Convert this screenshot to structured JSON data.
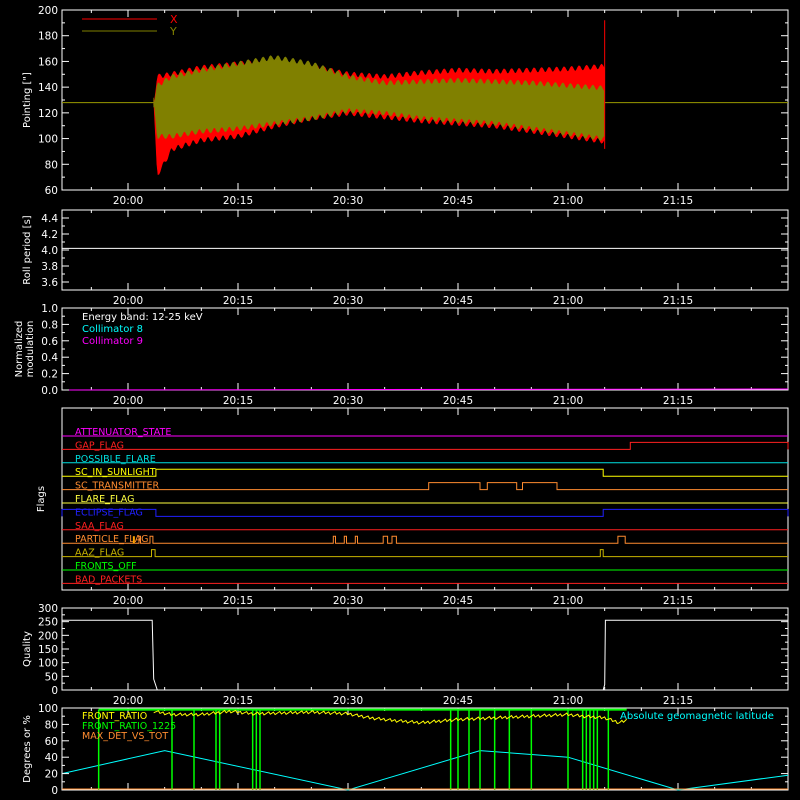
{
  "figure": {
    "background": "#000000",
    "foreground": "#ffffff"
  },
  "time_axis": {
    "ticks": [
      "20:00",
      "20:15",
      "20:30",
      "20:45",
      "21:00",
      "21:15"
    ],
    "tick_minutes": [
      1200,
      1215,
      1230,
      1245,
      1260,
      1275
    ],
    "range_minutes": [
      1191,
      1290
    ]
  },
  "chart_data": [
    {
      "id": "pointing",
      "type": "area",
      "ylabel": "Pointing [\"]",
      "ylim": [
        60,
        200
      ],
      "yticks": [
        60,
        80,
        100,
        120,
        140,
        160,
        180,
        200
      ],
      "legend": [
        {
          "name": "X",
          "color": "#ff0000"
        },
        {
          "name": "Y",
          "color": "#808000"
        }
      ],
      "baseline": {
        "y": 128,
        "color": "#9a9a00"
      },
      "data_span_minutes": [
        1203.5,
        1265
      ],
      "series": [
        {
          "name": "X",
          "color": "#ff0000",
          "x": [
            1203.5,
            1204,
            1206,
            1210,
            1215,
            1220,
            1225,
            1230,
            1235,
            1240,
            1245,
            1250,
            1255,
            1260,
            1265
          ],
          "upper": [
            128,
            150,
            152,
            157,
            160,
            162,
            158,
            152,
            150,
            153,
            155,
            154,
            155,
            156,
            158
          ],
          "lower": [
            128,
            70,
            90,
            97,
            100,
            108,
            114,
            118,
            115,
            112,
            110,
            108,
            104,
            100,
            96
          ]
        },
        {
          "name": "Y",
          "color": "#808000",
          "x": [
            1203.5,
            1204,
            1206,
            1210,
            1215,
            1220,
            1225,
            1230,
            1235,
            1240,
            1245,
            1250,
            1255,
            1260,
            1265
          ],
          "upper": [
            128,
            143,
            150,
            155,
            160,
            165,
            160,
            150,
            145,
            146,
            147,
            146,
            145,
            143,
            141
          ],
          "lower": [
            128,
            100,
            100,
            104,
            106,
            110,
            114,
            120,
            118,
            114,
            112,
            110,
            106,
            102,
            98
          ]
        }
      ]
    },
    {
      "id": "roll",
      "type": "line",
      "ylabel": "Roll period [s]",
      "ylim": [
        3.5,
        4.5
      ],
      "yticks": [
        3.6,
        3.8,
        4.0,
        4.2,
        4.4
      ],
      "series": [
        {
          "name": "",
          "color": "#ffffff",
          "x": [
            1191,
            1290
          ],
          "y": [
            4.02,
            4.02
          ]
        }
      ]
    },
    {
      "id": "modulation",
      "type": "line",
      "ylabel": [
        "Normalized",
        "modulation"
      ],
      "ylim": [
        0,
        1
      ],
      "yticks": [
        0.0,
        0.2,
        0.4,
        0.6,
        0.8,
        1.0
      ],
      "text_lines": [
        {
          "text": "Energy band: 12-25 keV",
          "color": "#ffffff"
        },
        {
          "text": "Collimator 8",
          "color": "#00ffff"
        },
        {
          "text": "Collimator 9",
          "color": "#ff00ff"
        }
      ],
      "series": [
        {
          "name": "Collimator 9",
          "color": "#ff00ff",
          "x": [
            1191,
            1290
          ],
          "y": [
            0,
            0
          ]
        }
      ]
    },
    {
      "id": "flags",
      "type": "line",
      "ylabel": "Flags",
      "flags": [
        {
          "name": "ATTENUATOR_STATE",
          "color": "#ff00ff",
          "segments": []
        },
        {
          "name": "GAP_FLAG",
          "color": "#ff2020",
          "segments": [
            [
              1268.5,
              1290
            ]
          ]
        },
        {
          "name": "POSSIBLE_FLARE",
          "color": "#00e0e0",
          "segments": []
        },
        {
          "name": "SC_IN_SUNLIGHT",
          "color": "#ffff00",
          "segments": [
            [
              1203.8,
              1264.8
            ]
          ]
        },
        {
          "name": "SC_TRANSMITTER",
          "color": "#ff8c30",
          "segments": [
            [
              1241,
              1248
            ],
            [
              1249,
              1253
            ],
            [
              1253.8,
              1258.5
            ]
          ]
        },
        {
          "name": "FLARE_FLAG",
          "color": "#ffff40",
          "segments": []
        },
        {
          "name": "ECLIPSE_FLAG",
          "color": "#2020ff",
          "segments": [
            [
              1191,
              1203.8
            ],
            [
              1264.8,
              1290
            ]
          ]
        },
        {
          "name": "SAA_FLAG",
          "color": "#ff2020",
          "segments": []
        },
        {
          "name": "PARTICLE_FLAG",
          "color": "#ff8c30",
          "segments": [
            [
              1201.5,
              1201.7
            ],
            [
              1203,
              1203.4
            ],
            [
              1228,
              1228.3
            ],
            [
              1229.5,
              1229.8
            ],
            [
              1231,
              1231.3
            ],
            [
              1234.8,
              1235.4
            ],
            [
              1236,
              1236.6
            ],
            [
              1266.8,
              1267.8
            ]
          ],
          "marker": {
            "color": "#ffa500",
            "x": 1200.8
          }
        },
        {
          "name": "AAZ_FLAG",
          "color": "#c8b400",
          "segments": [
            [
              1203.2,
              1203.7
            ],
            [
              1264.4,
              1264.8
            ]
          ]
        },
        {
          "name": "FRONTS_OFF",
          "color": "#00ff00",
          "segments": []
        },
        {
          "name": "BAD_PACKETS",
          "color": "#ff2020",
          "segments": []
        }
      ]
    },
    {
      "id": "quality",
      "type": "line",
      "ylabel": "Quality",
      "ylim": [
        0,
        300
      ],
      "yticks": [
        0,
        50,
        100,
        150,
        200,
        250,
        300
      ],
      "series": [
        {
          "name": "",
          "color": "#ffffff",
          "x": [
            1191,
            1203.3,
            1203.5,
            1204,
            1264.8,
            1265,
            1265.1,
            1290
          ],
          "y": [
            255,
            255,
            40,
            0,
            0,
            20,
            255,
            255
          ]
        }
      ]
    },
    {
      "id": "ratios",
      "type": "line",
      "ylabel": "Degrees or %",
      "ylim": [
        0,
        100
      ],
      "yticks": [
        0,
        20,
        40,
        60,
        80,
        100
      ],
      "legend": [
        {
          "name": "FRONT_RATIO",
          "color": "#ffff00"
        },
        {
          "name": "FRONT_RATIO_1225",
          "color": "#00ff00"
        },
        {
          "name": "MAX_DET_VS_TOT",
          "color": "#ff8c30"
        }
      ],
      "right_label": {
        "text": "Absolute geomagnetic latitude",
        "color": "#00ffff"
      },
      "latitude": {
        "color": "#00ffff",
        "x": [
          1191,
          1205,
          1230,
          1248,
          1260,
          1275,
          1290
        ],
        "y": [
          20,
          48,
          0,
          48,
          40,
          0,
          18
        ]
      },
      "front_ratio": {
        "color": "#ffff00",
        "x": [
          1203.5,
          1206,
          1210,
          1214,
          1217,
          1225,
          1230,
          1233,
          1236,
          1240,
          1245,
          1250,
          1255,
          1260,
          1262,
          1265,
          1267,
          1268
        ],
        "y": [
          96,
          92,
          92,
          96,
          93,
          95,
          93,
          88,
          85,
          82,
          86,
          88,
          90,
          92,
          90,
          88,
          82,
          85
        ]
      },
      "front_ratio_1225": {
        "color": "#00ff00",
        "top": 98,
        "drops_x": [
          1196,
          1206,
          1209,
          1212,
          1212.5,
          1217,
          1217.5,
          1218,
          1244,
          1245,
          1246.5,
          1248,
          1250,
          1252,
          1255,
          1260,
          1262,
          1262.5,
          1263,
          1263.5,
          1264,
          1265.5
        ],
        "top_x": [
          1196,
          1268
        ]
      },
      "max_det": {
        "color": "#ff8c30",
        "x": [
          1191,
          1290
        ],
        "y": [
          0,
          0
        ]
      }
    }
  ]
}
